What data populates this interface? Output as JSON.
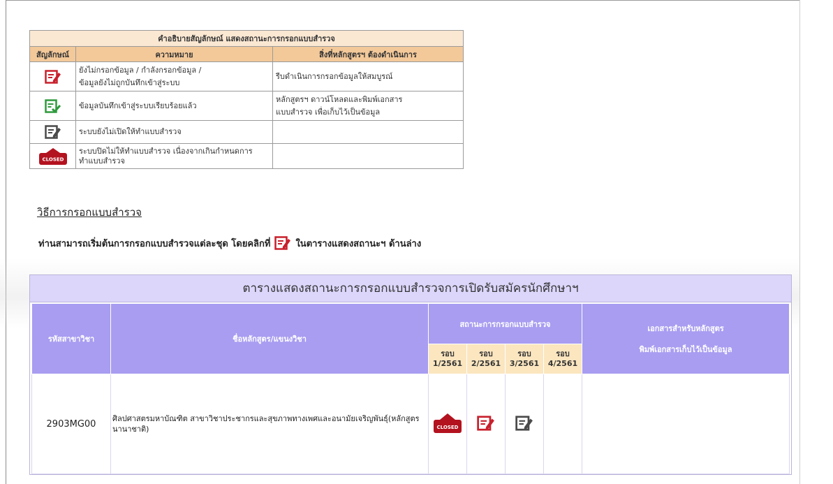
{
  "legend": {
    "caption": "คำอธิบายสัญลักษณ์ แสดงสถานะการกรอกแบบสำรวจ",
    "col_symbol": "สัญลักษณ์",
    "col_meaning": "ความหมาย",
    "col_action": "สิ่งที่หลักสูตรฯ ต้องดำเนินการ",
    "rows": [
      {
        "icon": "edit-red-icon",
        "meaning_1": "ยังไม่กรอกข้อมูล / กำลังกรอกข้อมูล /",
        "meaning_2": "ข้อมูลยังไม่ถูกบันทึกเข้าสู่ระบบ",
        "action_1": "รีบดำเนินการกรอกข้อมูลให้สมบูรณ์",
        "action_2": ""
      },
      {
        "icon": "check-green-icon",
        "meaning_1": "ข้อมูลบันทึกเข้าสู่ระบบเรียบร้อยแล้ว",
        "meaning_2": "",
        "action_1": "หลักสูตรฯ ดาวน์โหลดและพิมพ์เอกสาร",
        "action_2": "แบบสำรวจ เพื่อเก็บไว้เป็นข้อมูล"
      },
      {
        "icon": "edit-gray-icon",
        "meaning_1": "ระบบยังไม่เปิดให้ทำแบบสำรวจ",
        "meaning_2": "",
        "action_1": "",
        "action_2": ""
      },
      {
        "icon": "closed-sign-icon",
        "meaning_1": "ระบบปิดไม่ให้ทำแบบสำรวจ เนื่องจากเกินกำหนดการ",
        "meaning_2": "ทำแบบสำรวจ",
        "action_1": "",
        "action_2": ""
      }
    ]
  },
  "howto": {
    "title": "วิธีการกรอกแบบสำรวจ",
    "text_before": "ท่านสามารถเริ่มต้นการกรอกแบบสำรวจแต่ละชุด โดยคลิกที่",
    "text_after": "ในตารางแสดงสถานะฯ ด้านล่าง"
  },
  "status_table": {
    "title": "ตารางแสดงสถานะการกรอกแบบสำรวจการเปิดรับสมัครนักศึกษาฯ",
    "col_code": "รหัสสาขาวิชา",
    "col_name": "ชื่อหลักสูตร/แขนงวิชา",
    "col_status": "สถานะการกรอกแบบสำรวจ",
    "col_docs_1": "เอกสารสำหรับหลักสูตร",
    "col_docs_2": "พิมพ์เอกสารเก็บไว้เป็นข้อมูล",
    "rounds": [
      {
        "l1": "รอบ",
        "l2": "1/2561"
      },
      {
        "l1": "รอบ",
        "l2": "2/2561"
      },
      {
        "l1": "รอบ",
        "l2": "3/2561"
      },
      {
        "l1": "รอบ",
        "l2": "4/2561"
      }
    ],
    "rows": [
      {
        "code": "2903MG00",
        "name": "ศิลปศาสตรมหาบัณฑิต สาขาวิชาประชากรและสุขภาพทางเพศและอนามัยเจริญพันธุ์(หลักสูตรนานาชาติ)",
        "statuses": [
          "closed-sign-icon",
          "edit-red-icon",
          "edit-gray-icon",
          ""
        ]
      }
    ]
  },
  "colors": {
    "legend_caption_bg": "#fbe8d3",
    "legend_header_bg": "#f3c99a",
    "panel_title_bg": "#dcd6fb",
    "status_header_bg": "#a89df1",
    "round_header_bg": "#fbe6c0"
  }
}
